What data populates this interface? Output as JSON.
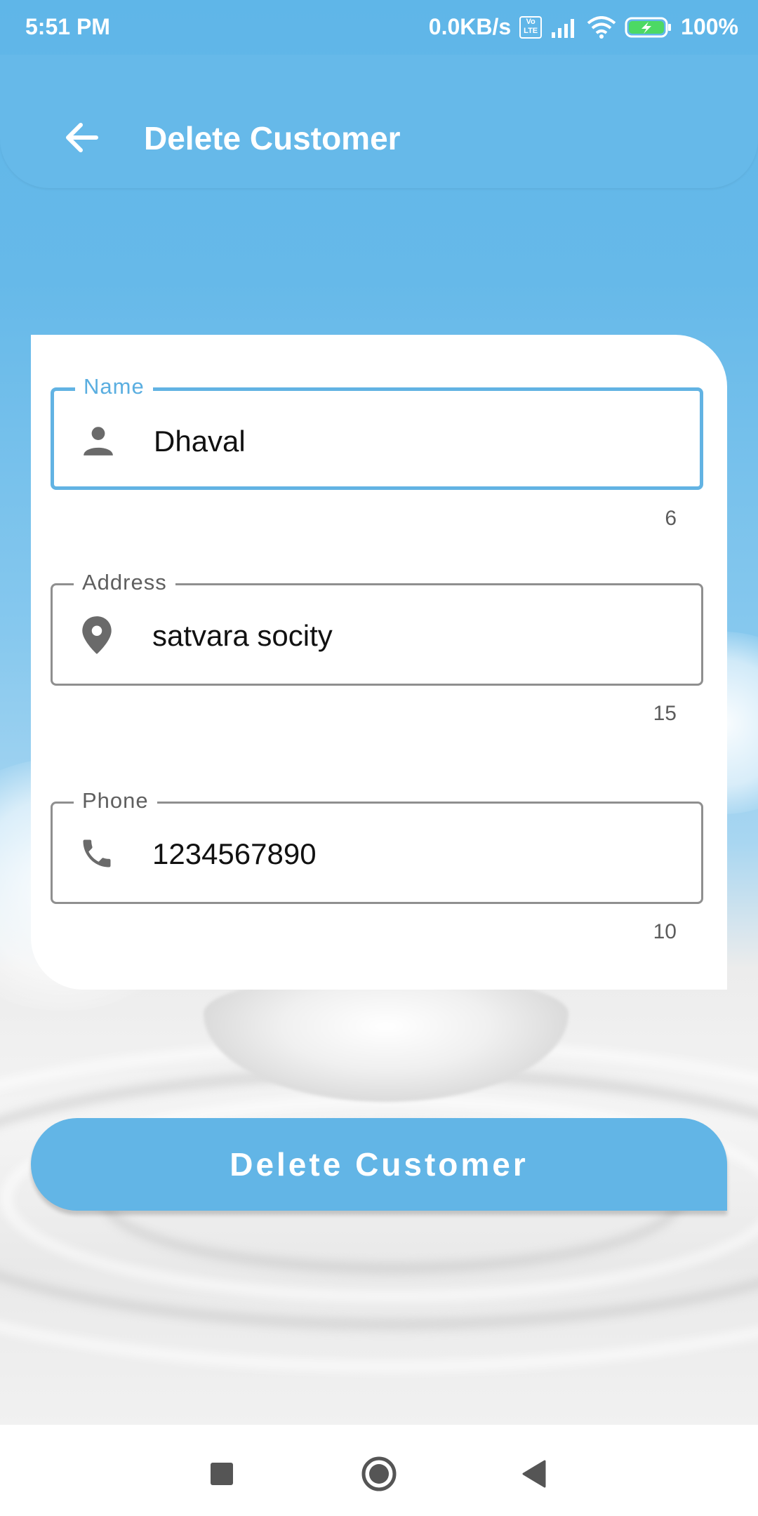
{
  "status_bar": {
    "time": "5:51 PM",
    "speed": "0.0KB/s",
    "volte": "Vo LTE",
    "battery": "100%"
  },
  "app_bar": {
    "title": "Delete Customer",
    "back_icon": "arrow-back-icon"
  },
  "form": {
    "name": {
      "label": "Name",
      "value": "Dhaval",
      "counter": "6",
      "icon": "person-icon"
    },
    "address": {
      "label": "Address",
      "value": "satvara socity",
      "counter": "15",
      "icon": "location-pin-icon"
    },
    "phone": {
      "label": "Phone",
      "value": "1234567890",
      "counter": "10",
      "icon": "phone-icon"
    }
  },
  "actions": {
    "delete_label": "Delete Customer"
  },
  "colors": {
    "primary": "#62b5e6",
    "focus_border": "#62b3e3",
    "text": "#111111"
  }
}
